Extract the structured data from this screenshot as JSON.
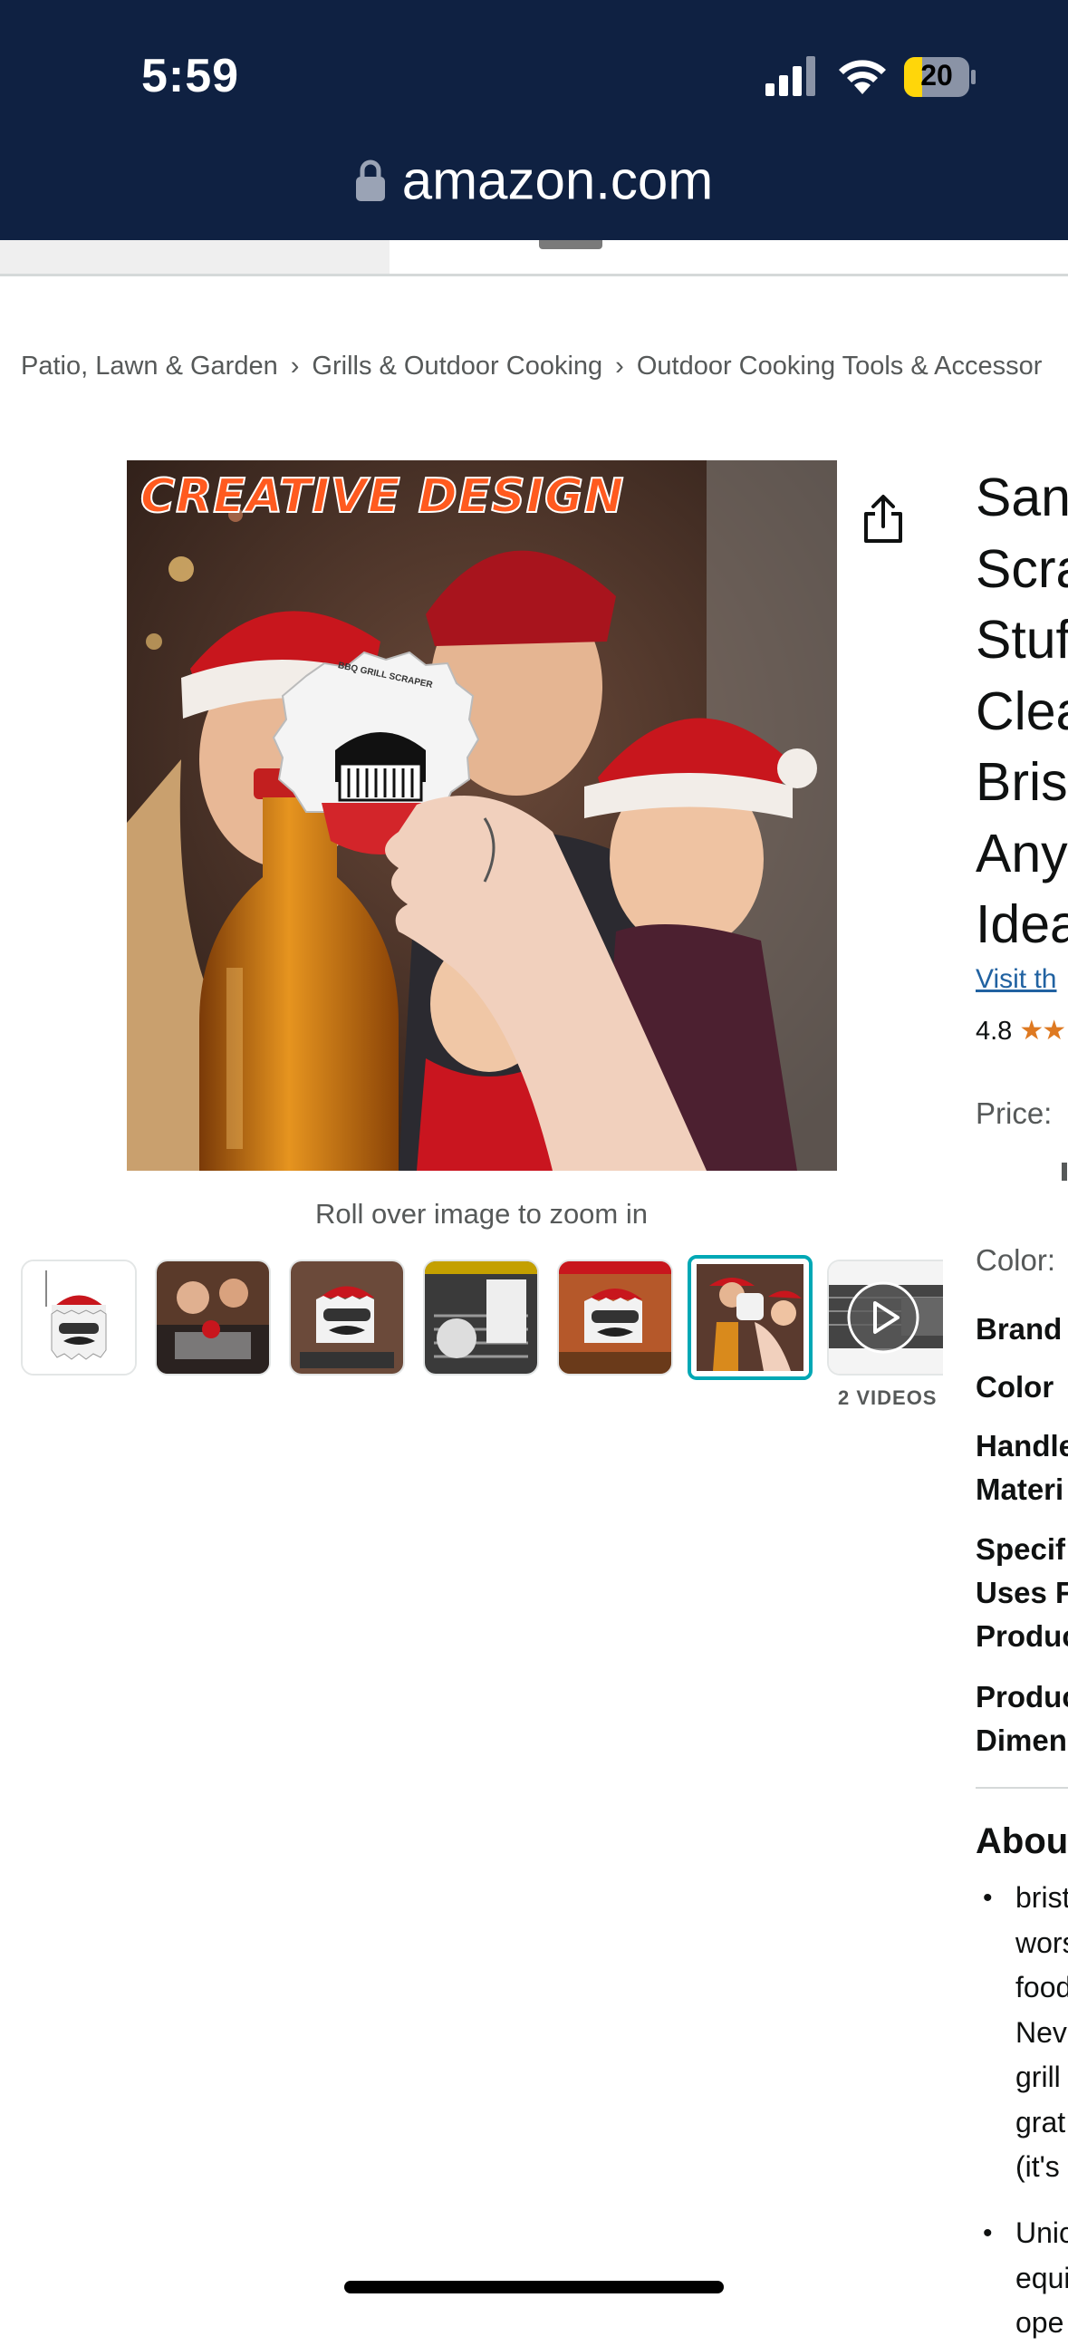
{
  "status_bar": {
    "time": "5:59",
    "battery_level": "20",
    "url": "amazon.com"
  },
  "breadcrumb": {
    "items": [
      "Patio, Lawn & Garden",
      "Grills & Outdoor Cooking",
      "Outdoor Cooking Tools & Accessor"
    ],
    "separator": "›"
  },
  "gallery": {
    "main_image_banner": "CREATIVE DESIGN",
    "scraper_text": "BBQ GRILL SCRAPER",
    "zoom_hint": "Roll over image to zoom in",
    "thumbnail_count": 7,
    "selected_index": 5,
    "videos_label": "2 VIDEOS"
  },
  "product": {
    "title_lines": [
      "Sant",
      "Scra",
      "Stuf",
      "Clea",
      "Brist",
      "Any",
      "Idea"
    ],
    "visit_store": "Visit th",
    "rating_value": "4.8",
    "rating_stars": "★★",
    "price_label": "Price:",
    "color_label": "Color:",
    "specs": [
      {
        "line1": "Brand",
        "line2": ""
      },
      {
        "line1": "Color",
        "line2": ""
      },
      {
        "line1": "Handle",
        "line2": "Materi"
      },
      {
        "line1": "Specif",
        "line2": "Uses F",
        "line3": "Produc"
      },
      {
        "line1": "Produc",
        "line2": "Dimen"
      }
    ],
    "about_heading": "About",
    "bullets": [
      [
        "brist",
        "wors",
        "food",
        "Neve",
        "grill",
        "grat",
        "(it's"
      ],
      [
        "Unic",
        "equi",
        "ope"
      ]
    ]
  },
  "colors": {
    "header_bg": "#0f2142",
    "link": "#2162a1",
    "star": "#de7921",
    "selected_thumb": "#00a8b5"
  }
}
